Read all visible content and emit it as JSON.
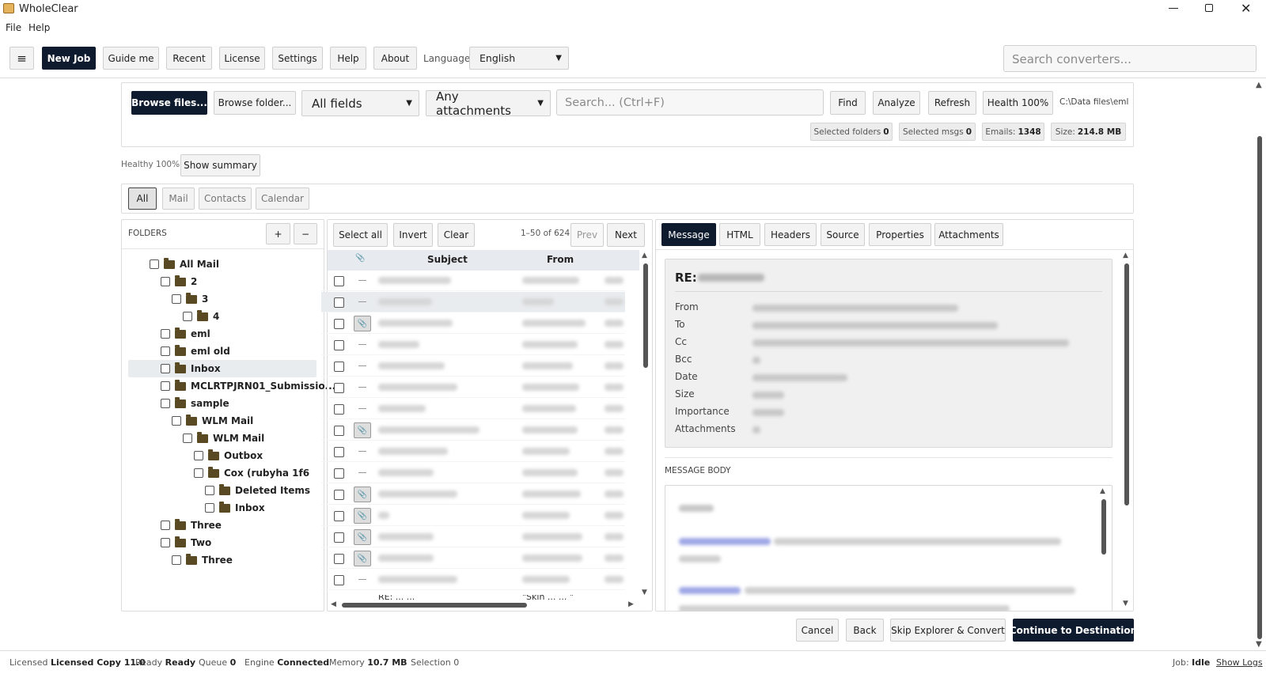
{
  "window": {
    "title": "WholeClear"
  },
  "menu": [
    "File",
    "Help"
  ],
  "toolbar": {
    "menu_icon": "≡",
    "buttons": [
      "New Job",
      "Guide me",
      "Recent",
      "License",
      "Settings",
      "Help",
      "About"
    ],
    "language_label": "Language",
    "language_value": "English",
    "search_placeholder": "Search converters..."
  },
  "filebar": {
    "browse_files": "Browse files...",
    "browse_folder": "Browse folder...",
    "fields": "All fields",
    "attachments": "Any attachments",
    "search_placeholder": "Search... (Ctrl+F)",
    "find": "Find",
    "analyze": "Analyze",
    "refresh": "Refresh",
    "health": "Health 100%",
    "path": "C:\\Data files\\eml"
  },
  "stats": [
    {
      "label": "Selected folders",
      "value": "0"
    },
    {
      "label": "Selected msgs",
      "value": "0"
    },
    {
      "label": "Emails:",
      "value": "1348"
    },
    {
      "label": "Size:",
      "value": "214.8 MB"
    }
  ],
  "health": {
    "text": "Healthy 100%",
    "summary_button": "Show summary"
  },
  "filters": [
    "All",
    "Mail",
    "Contacts",
    "Calendar"
  ],
  "folders": {
    "title": "FOLDERS",
    "add": "+",
    "remove": "−",
    "items": [
      {
        "name": "All Mail",
        "level": 0
      },
      {
        "name": "2",
        "level": 1
      },
      {
        "name": "3",
        "level": 2
      },
      {
        "name": "4",
        "level": 3
      },
      {
        "name": "eml",
        "level": 1
      },
      {
        "name": "eml old",
        "level": 1
      },
      {
        "name": "Inbox",
        "level": 1,
        "selected": true
      },
      {
        "name": "MCLRTPJRN01_Submissio...",
        "level": 1
      },
      {
        "name": "sample",
        "level": 1
      },
      {
        "name": "WLM Mail",
        "level": 2
      },
      {
        "name": "WLM Mail",
        "level": 3
      },
      {
        "name": "Outbox",
        "level": 4
      },
      {
        "name": "Cox (rubyha 1f6",
        "level": 4
      },
      {
        "name": "Deleted Items",
        "level": 5
      },
      {
        "name": "Inbox",
        "level": 5
      },
      {
        "name": "Three",
        "level": 1
      },
      {
        "name": "Two",
        "level": 1
      },
      {
        "name": "Three",
        "level": 2
      }
    ]
  },
  "list": {
    "select_all": "Select all",
    "invert": "Invert",
    "clear": "Clear",
    "range": "1–50 of 624",
    "prev": "Prev",
    "next": "Next",
    "col_attach": "📎",
    "col_subject": "Subject",
    "col_from": "From",
    "rows": [
      {
        "a": false
      },
      {
        "a": false,
        "sel": true
      },
      {
        "a": true
      },
      {
        "a": false
      },
      {
        "a": false
      },
      {
        "a": false
      },
      {
        "a": false
      },
      {
        "a": true
      },
      {
        "a": false
      },
      {
        "a": false
      },
      {
        "a": true
      },
      {
        "a": true
      },
      {
        "a": true
      },
      {
        "a": true
      },
      {
        "a": false
      }
    ],
    "partial_subject": "RE: ... ...",
    "partial_from": "\"Skin ... ... \""
  },
  "preview": {
    "tabs": [
      "Message",
      "HTML",
      "Headers",
      "Source",
      "Properties",
      "Attachments"
    ],
    "subject": "RE:",
    "labels": [
      "From",
      "To",
      "Cc",
      "Bcc",
      "Date",
      "Size",
      "Importance",
      "Attachments"
    ],
    "body_title": "MESSAGE BODY"
  },
  "actions": {
    "cancel": "Cancel",
    "back": "Back",
    "skip": "Skip Explorer & Convert",
    "continue": "Continue to Destination"
  },
  "status": [
    {
      "label": "Licensed",
      "value": "Licensed Copy 11.0"
    },
    {
      "label": "Ready",
      "value": "Ready"
    },
    {
      "label": "Queue",
      "value": "0"
    },
    {
      "label": "Engine",
      "value": "Connected"
    },
    {
      "label": "Memory",
      "value": "10.7 MB"
    },
    {
      "label": "Selection",
      "value": "0"
    }
  ],
  "status_right": {
    "job_label": "Job:",
    "job_value": "Idle",
    "logs": "Show Logs"
  }
}
